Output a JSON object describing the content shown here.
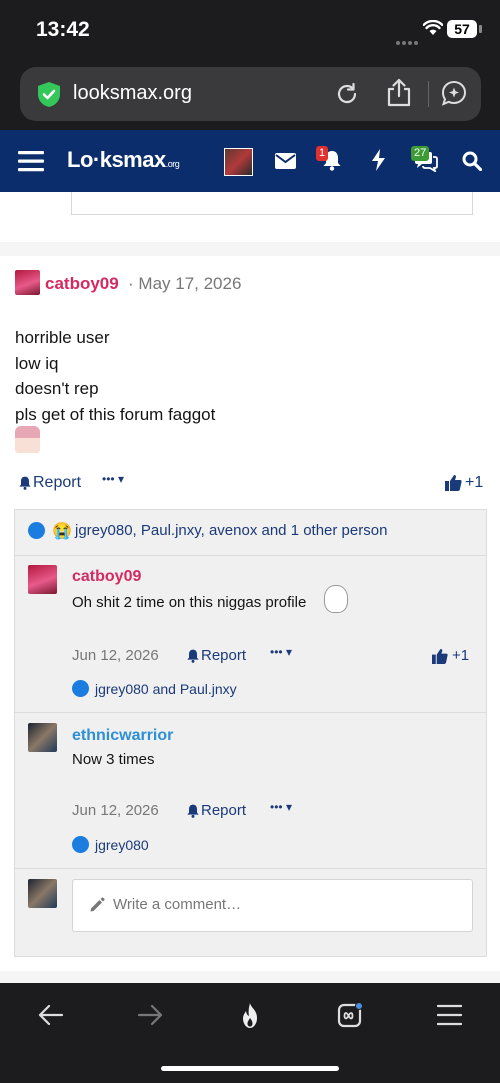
{
  "status": {
    "time": "13:42",
    "battery": "57"
  },
  "browser": {
    "url": "looksmax.org"
  },
  "nav": {
    "logo_main": "Lo·ksmax",
    "logo_suffix": ".org",
    "alerts_badge": "1",
    "conversations_badge": "27"
  },
  "post": {
    "author": "catboy09",
    "date_sep": "·",
    "date": "May 17, 2026",
    "lines": [
      "horrible user",
      "low iq",
      "doesn't rep",
      "pls get of this forum faggot"
    ],
    "report_label": "Report",
    "more_label": "•••",
    "reaction_count": "+1",
    "reactions_text": "jgrey080, Paul.jnxy, avenox and 1 other person"
  },
  "comments": [
    {
      "author": "catboy09",
      "author_color": "#d42a62",
      "text": "Oh shit 2 time on this niggas profile",
      "date": "Jun 12, 2026",
      "report_label": "Report",
      "more_label": "•••",
      "reaction_count": "+1",
      "reactions_text": "jgrey080 and Paul.jnxy"
    },
    {
      "author": "ethnicwarrior",
      "author_color": "#2d8fd5",
      "text": "Now 3 times",
      "date": "Jun 12, 2026",
      "report_label": "Report",
      "more_label": "•••",
      "reactions_text": "jgrey080"
    }
  ],
  "comment_box": {
    "placeholder": "Write a comment…"
  },
  "colors": {
    "nav_bg": "#0c2d6b",
    "link": "#1a3a7a",
    "like_blue": "#1b7de0"
  }
}
